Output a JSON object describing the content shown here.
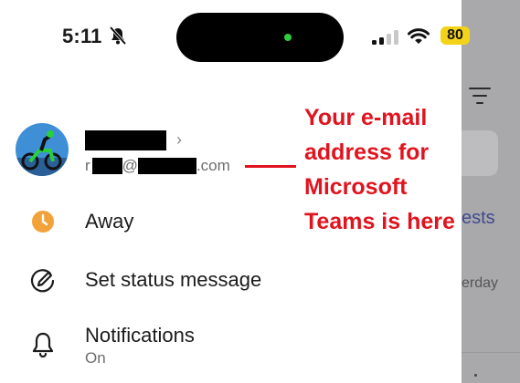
{
  "status_bar": {
    "time": "5:11",
    "battery": "80"
  },
  "backdrop": {
    "link_fragment": "ests",
    "day_fragment": "erday"
  },
  "profile": {
    "email_prefix": "r",
    "email_at": "@",
    "email_domain": ".com"
  },
  "annotation": {
    "lines": [
      "Your e-mail",
      "address for",
      "Microsoft",
      "Teams is here"
    ],
    "color": "#e0141e"
  },
  "menu": {
    "items": [
      {
        "label": "Away",
        "icon": "away-clock-icon"
      },
      {
        "label": "Set status message",
        "icon": "edit-status-icon"
      },
      {
        "label": "Notifications",
        "sublabel": "On",
        "icon": "bell-icon"
      }
    ]
  },
  "colors": {
    "away": "#f3a23a",
    "backdrop": "#a9a9ab"
  }
}
